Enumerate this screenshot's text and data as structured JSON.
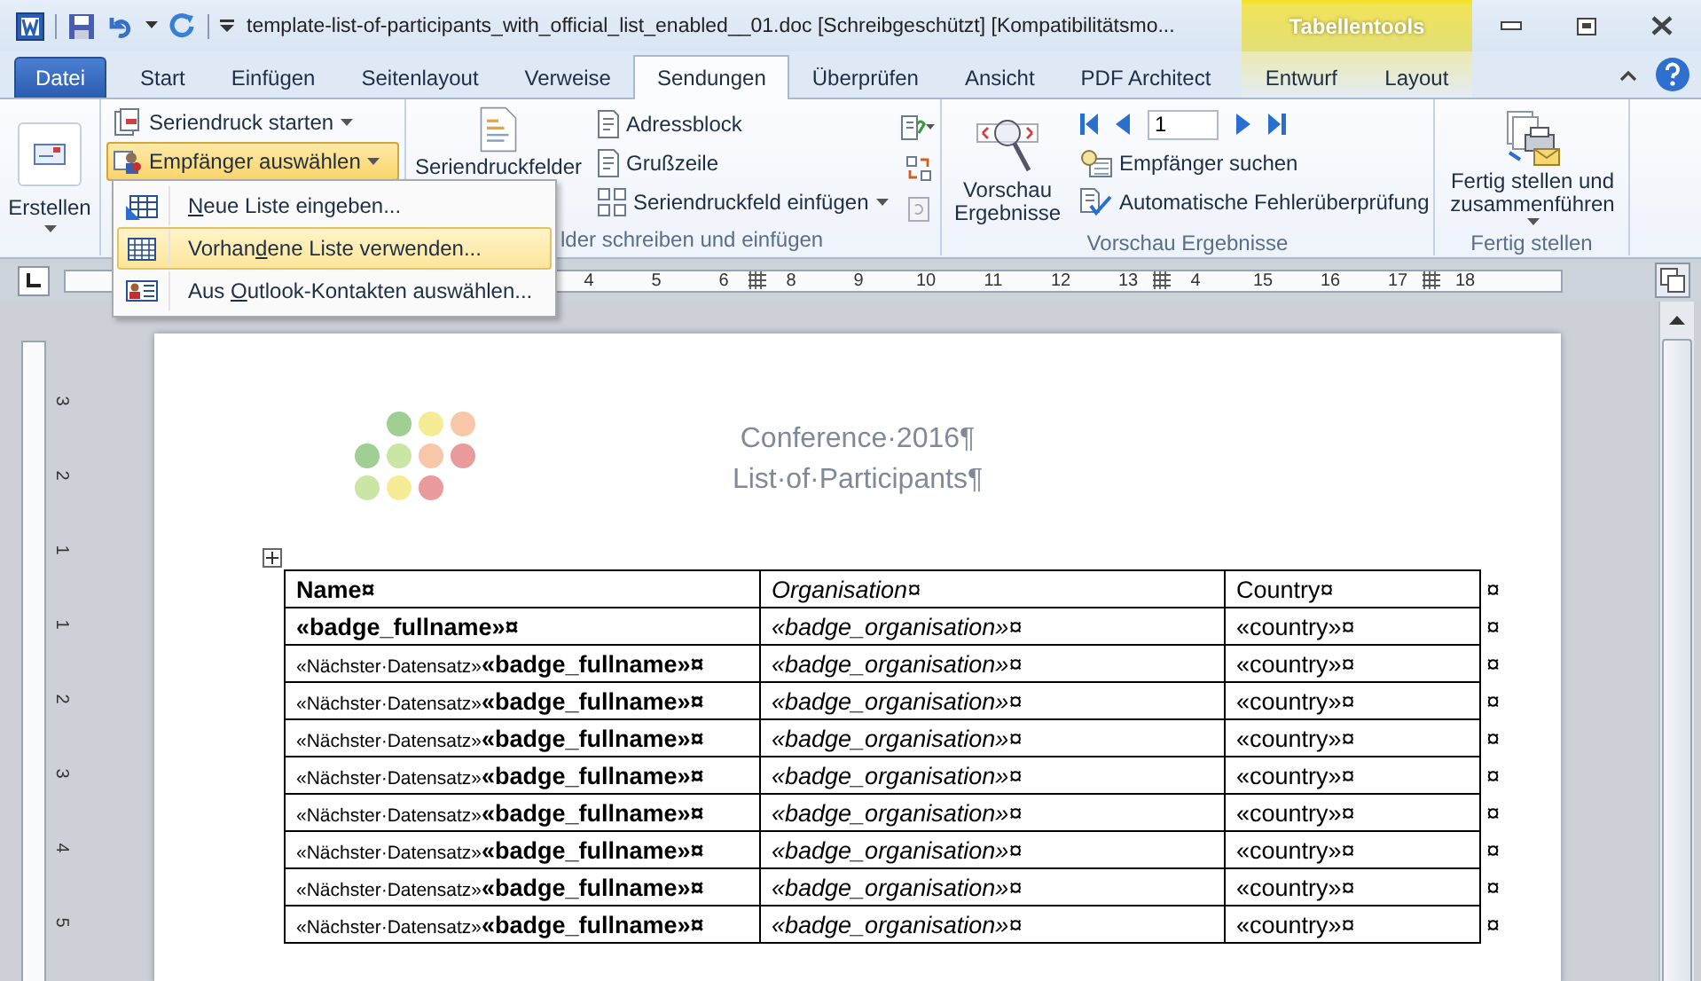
{
  "window": {
    "title": "template-list-of-participants_with_official_list_enabled__01.doc [Schreibgeschützt] [Kompatibilitätsmo...",
    "context_title": "Tabellentools"
  },
  "tabs": [
    {
      "label": "Datei",
      "kind": "file",
      "selected": false
    },
    {
      "label": "Start",
      "kind": "normal",
      "selected": false
    },
    {
      "label": "Einfügen",
      "kind": "normal",
      "selected": false
    },
    {
      "label": "Seitenlayout",
      "kind": "normal",
      "selected": false
    },
    {
      "label": "Verweise",
      "kind": "normal",
      "selected": false
    },
    {
      "label": "Sendungen",
      "kind": "normal",
      "selected": true
    },
    {
      "label": "Überprüfen",
      "kind": "normal",
      "selected": false
    },
    {
      "label": "Ansicht",
      "kind": "normal",
      "selected": false
    },
    {
      "label": "PDF Architect",
      "kind": "normal",
      "selected": false
    },
    {
      "label": "Entwurf",
      "kind": "context",
      "selected": false
    },
    {
      "label": "Layout",
      "kind": "context",
      "selected": false
    }
  ],
  "ribbon": {
    "create": {
      "label": "Erstellen",
      "dropdown": true
    },
    "start": {
      "buttons": [
        {
          "label": "Seriendruck starten",
          "dropdown": true,
          "selected": false
        },
        {
          "label": "Empfänger auswählen",
          "dropdown": true,
          "selected": true
        }
      ]
    },
    "fields": {
      "big_button": "Seriendruckfelder",
      "buttons": [
        {
          "label": "Adressblock",
          "dropdown": false
        },
        {
          "label": "Grußzeile",
          "dropdown": false
        },
        {
          "label": "Seriendruckfeld einfügen",
          "dropdown": true
        }
      ],
      "group_label": "lder schreiben und einfügen"
    },
    "preview": {
      "big_button": "Vorschau Ergebnisse",
      "record": "1",
      "buttons": [
        "Empfänger suchen",
        "Automatische Fehlerüberprüfung"
      ],
      "group_label": "Vorschau Ergebnisse"
    },
    "finish": {
      "big_button": "Fertig stellen und zusammenführen",
      "dropdown": true,
      "group_label": "Fertig stellen"
    }
  },
  "menu": {
    "items": [
      {
        "key": "N",
        "post": "eue Liste eingeben...",
        "selected": false
      },
      {
        "pre": "Vorhan",
        "key": "d",
        "post": "ene Liste verwenden...",
        "selected": true
      },
      {
        "pre": "Aus ",
        "key": "O",
        "post": "utlook-Kontakten auswählen...",
        "selected": false
      }
    ]
  },
  "ruler": {
    "marks": [
      {
        "kind": "number",
        "text": "4"
      },
      {
        "kind": "number",
        "text": "5"
      },
      {
        "kind": "number",
        "text": "6"
      },
      {
        "kind": "column"
      },
      {
        "kind": "number",
        "text": "8"
      },
      {
        "kind": "number",
        "text": "9"
      },
      {
        "kind": "number",
        "text": "10"
      },
      {
        "kind": "number",
        "text": "11"
      },
      {
        "kind": "number",
        "text": "12"
      },
      {
        "kind": "number",
        "text": "13"
      },
      {
        "kind": "column"
      },
      {
        "kind": "number",
        "text": "4"
      },
      {
        "kind": "number",
        "text": "15"
      },
      {
        "kind": "number",
        "text": "16"
      },
      {
        "kind": "number",
        "text": "17"
      },
      {
        "kind": "column"
      },
      {
        "kind": "number",
        "text": "18"
      }
    ]
  },
  "vertical_ruler": {
    "marks": [
      "3",
      "2",
      "1",
      "1",
      "2",
      "3",
      "4",
      "5"
    ]
  },
  "document": {
    "heading": [
      "Conference·2016¶",
      "List·of·Participants¶"
    ],
    "table": {
      "columns": [
        "Name¤",
        "Organisation¤",
        "Country¤"
      ],
      "row_end": "¤",
      "rows": [
        {
          "name": "«badge_fullname»¤",
          "organisation": "«badge_organisation»¤",
          "country": "«country»¤",
          "end": "¤"
        },
        {
          "prefix": "«Nächster·Datensatz»",
          "name": "«badge_fullname»¤",
          "organisation": "«badge_organisation»¤",
          "country": "«country»¤",
          "end": "¤"
        },
        {
          "prefix": "«Nächster·Datensatz»",
          "name": "«badge_fullname»¤",
          "organisation": "«badge_organisation»¤",
          "country": "«country»¤",
          "end": "¤"
        },
        {
          "prefix": "«Nächster·Datensatz»",
          "name": "«badge_fullname»¤",
          "organisation": "«badge_organisation»¤",
          "country": "«country»¤",
          "end": "¤"
        },
        {
          "prefix": "«Nächster·Datensatz»",
          "name": "«badge_fullname»¤",
          "organisation": "«badge_organisation»¤",
          "country": "«country»¤",
          "end": "¤"
        },
        {
          "prefix": "«Nächster·Datensatz»",
          "name": "«badge_fullname»¤",
          "organisation": "«badge_organisation»¤",
          "country": "«country»¤",
          "end": "¤"
        },
        {
          "prefix": "«Nächster·Datensatz»",
          "name": "«badge_fullname»¤",
          "organisation": "«badge_organisation»¤",
          "country": "«country»¤",
          "end": "¤"
        },
        {
          "prefix": "«Nächster·Datensatz»",
          "name": "«badge_fullname»¤",
          "organisation": "«badge_organisation»¤",
          "country": "«country»¤",
          "end": "¤"
        },
        {
          "prefix": "«Nächster·Datensatz»",
          "name": "«badge_fullname»¤",
          "organisation": "«badge_organisation»¤",
          "country": "«country»¤",
          "end": "¤"
        }
      ]
    }
  }
}
